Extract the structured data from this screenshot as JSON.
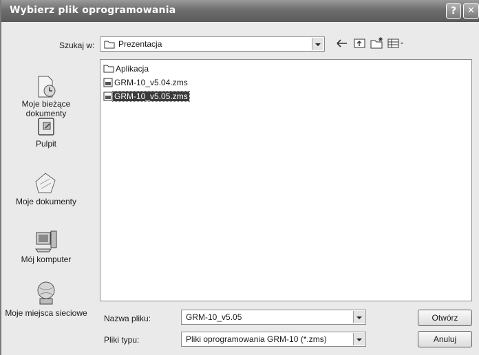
{
  "window": {
    "title": "Wybierz plik oprogramowania",
    "help_glyph": "?",
    "close_glyph": "✕"
  },
  "toolbar": {
    "lookin_label": "Szukaj w:",
    "lookin_value": "Prezentacja",
    "icons": [
      "back-arrow-icon",
      "up-folder-icon",
      "new-folder-icon",
      "view-menu-icon"
    ]
  },
  "places": [
    {
      "icon": "recent-documents-icon",
      "label": "Moje bieżące dokumenty"
    },
    {
      "icon": "desktop-icon",
      "label": "Pulpit"
    },
    {
      "icon": "my-documents-icon",
      "label": "Moje dokumenty"
    },
    {
      "icon": "my-computer-icon",
      "label": "Mój komputer"
    },
    {
      "icon": "network-places-icon",
      "label": "Moje miejsca sieciowe"
    }
  ],
  "files": [
    {
      "name": "Aplikacja",
      "icon": "folder-icon",
      "selected": false
    },
    {
      "name": "GRM-10_v5.04.zms",
      "icon": "file-icon",
      "selected": false
    },
    {
      "name": "GRM-10_v5.05.zms",
      "icon": "file-icon",
      "selected": true
    }
  ],
  "footer": {
    "filename_label": "Nazwa pliku:",
    "filename_value": "GRM-10_v5.05",
    "filetype_label": "Pliki typu:",
    "filetype_value": "Pliki oprogramowania GRM-10 (*.zms)",
    "open_label": "Otwórz",
    "cancel_label": "Anuluj"
  }
}
